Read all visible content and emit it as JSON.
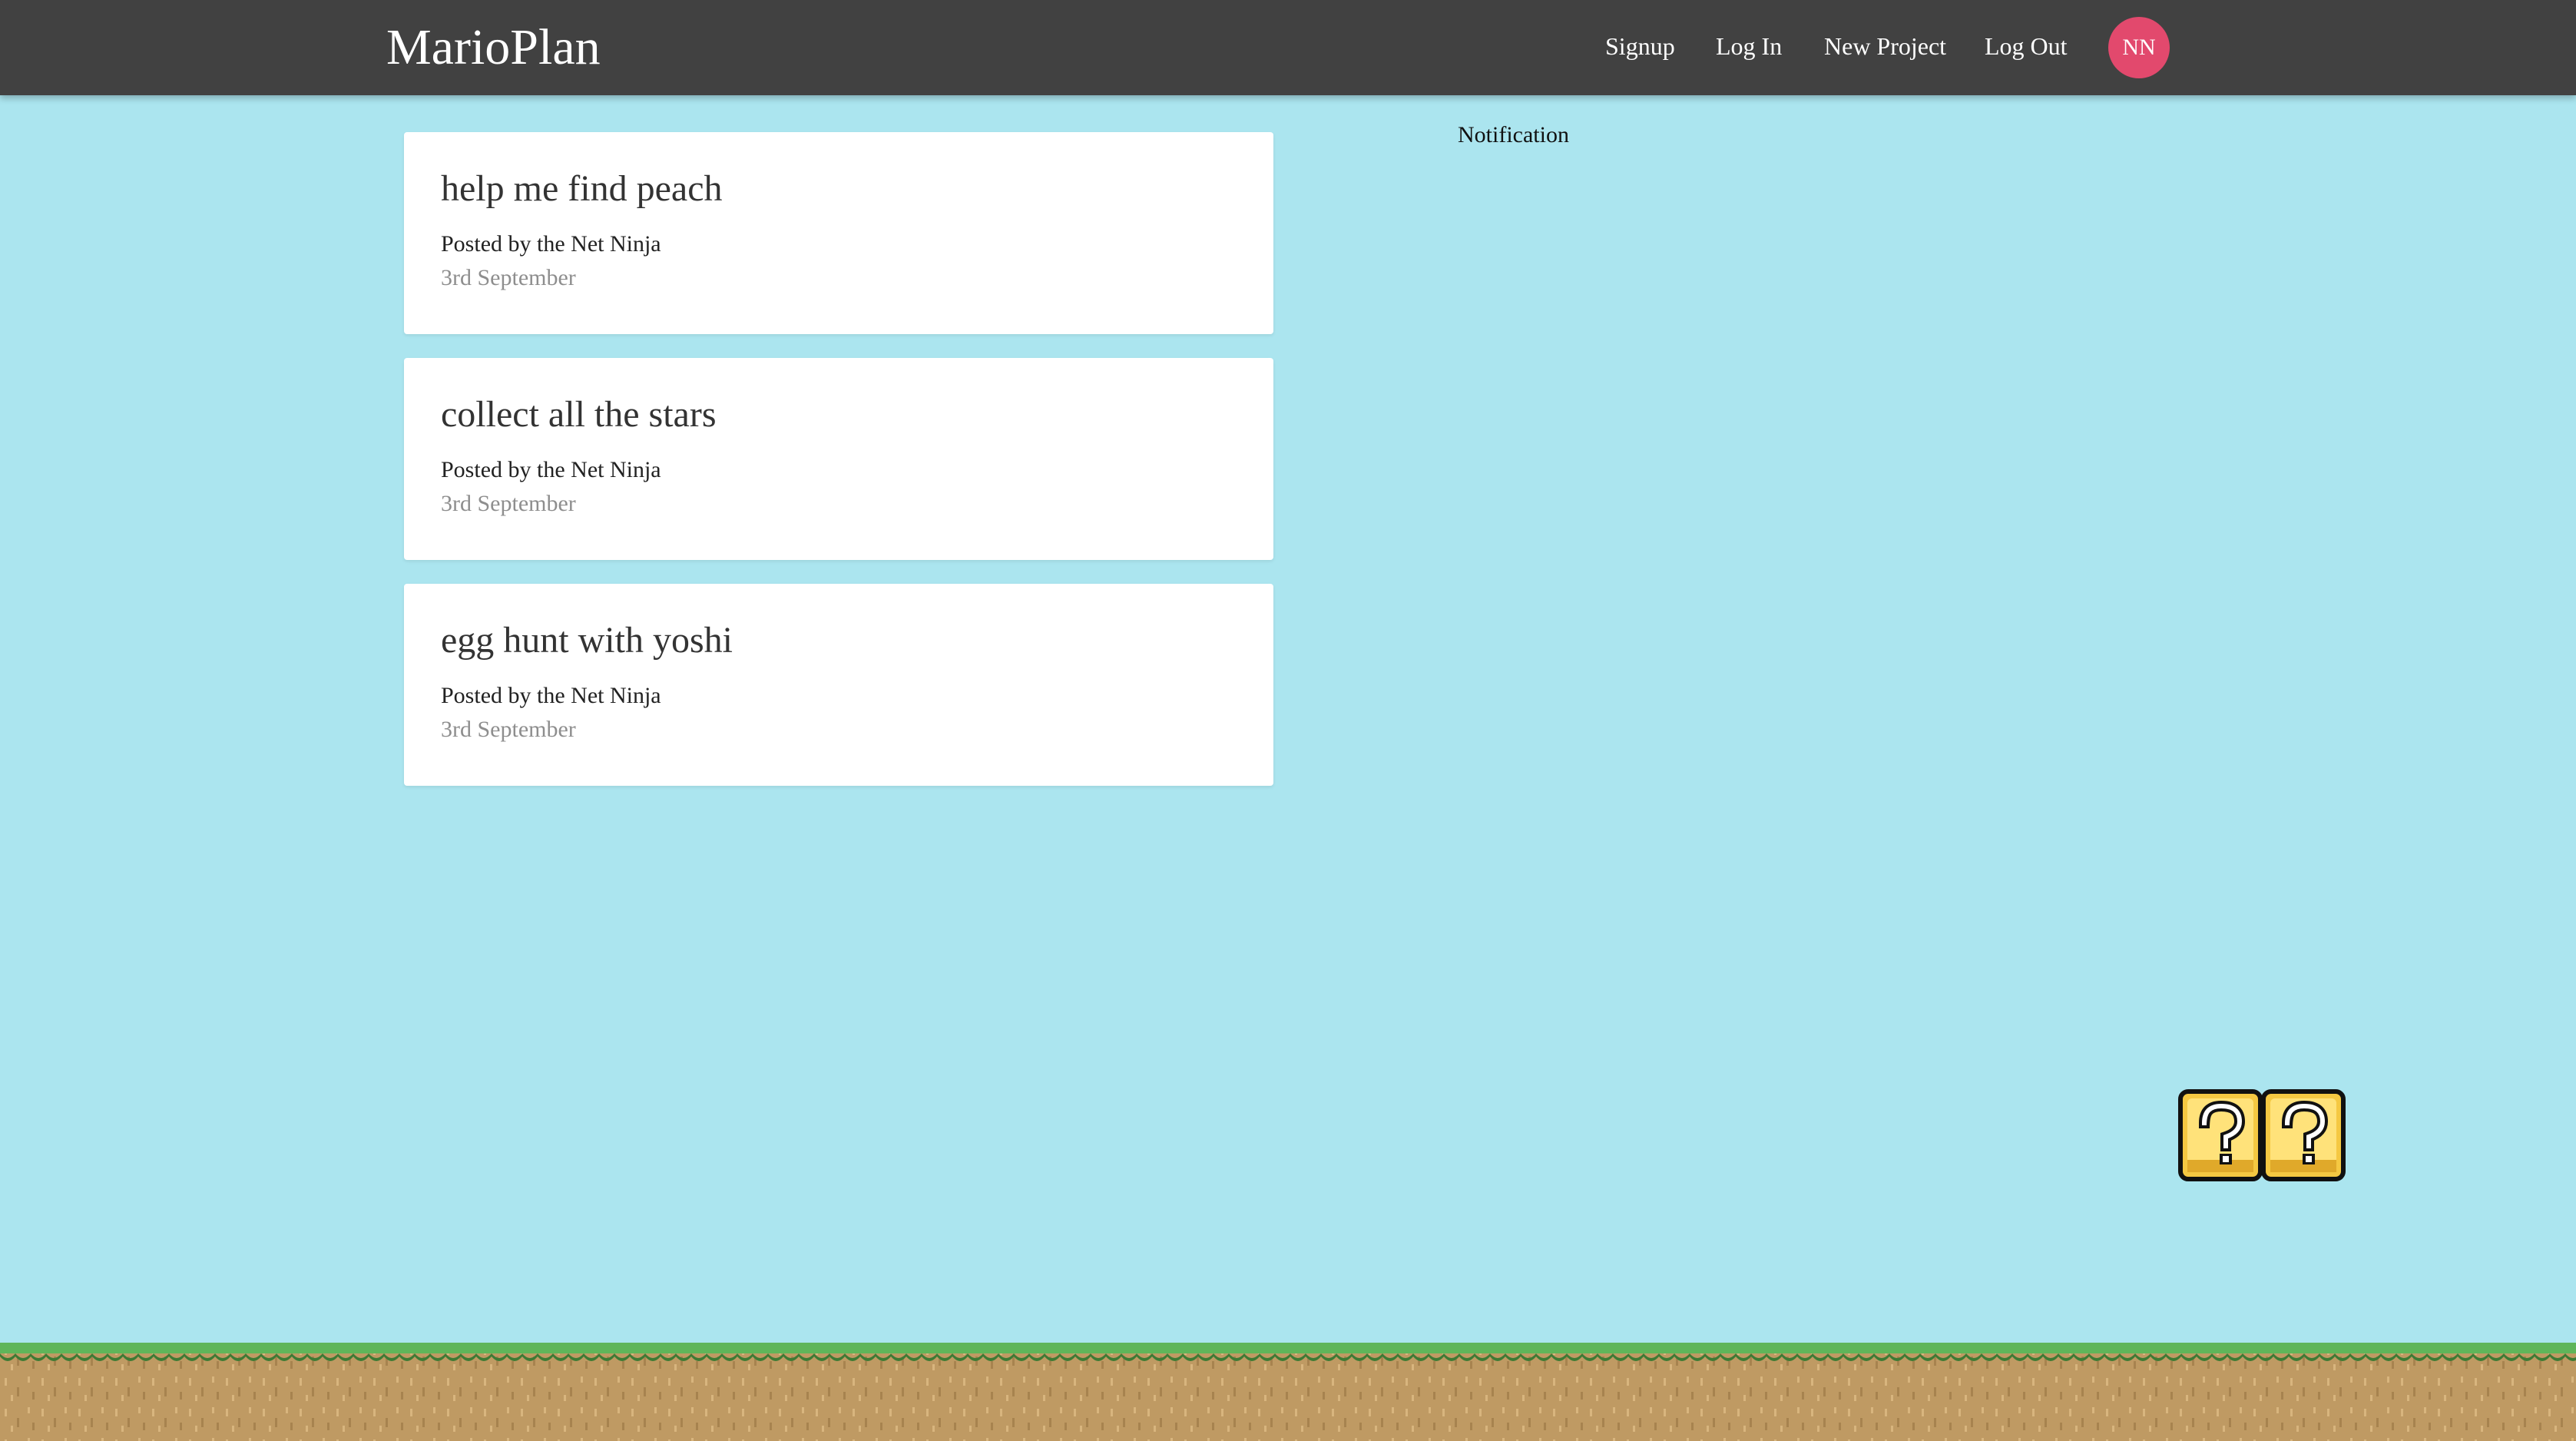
{
  "navbar": {
    "brand": "MarioPlan",
    "links": [
      "Signup",
      "Log In",
      "New Project",
      "Log Out"
    ],
    "avatar_initials": "NN"
  },
  "projects": [
    {
      "title": "help me find peach",
      "author": "Posted by the Net Ninja",
      "date": "3rd September"
    },
    {
      "title": "collect all the stars",
      "author": "Posted by the Net Ninja",
      "date": "3rd September"
    },
    {
      "title": "egg hunt with yoshi",
      "author": "Posted by the Net Ninja",
      "date": "3rd September"
    }
  ],
  "notifications": {
    "title": "Notification"
  },
  "decorations": {
    "blocks_icon": "question-block-icon",
    "ground_icon": "grass-ground"
  },
  "colors": {
    "background": "#abe5ef",
    "navbar": "#414141",
    "avatar": "#e2496d",
    "card": "#ffffff",
    "date_text": "#8e8e8e",
    "grass": "#5fb55a",
    "dirt": "#bf9a63"
  }
}
